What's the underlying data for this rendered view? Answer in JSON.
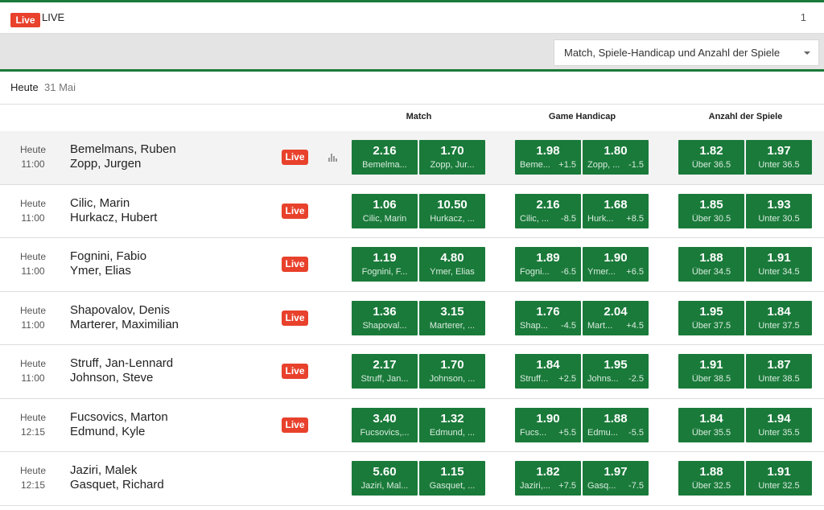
{
  "header": {
    "live_badge": "Live",
    "title": "LIVE",
    "count": "1"
  },
  "market_select": {
    "value": "Match, Spiele-Handicap und Anzahl der Spiele"
  },
  "datebar": {
    "day": "Heute",
    "date": "31 Mai"
  },
  "columns": {
    "match": "Match",
    "handicap": "Game Handicap",
    "total": "Anzahl der Spiele"
  },
  "live_label": "Live",
  "matches": [
    {
      "day": "Heute",
      "time": "11:00",
      "p1": "Bemelmans, Ruben",
      "p2": "Zopp, Jurgen",
      "live": true,
      "stats": true,
      "match": [
        {
          "v": "2.16",
          "n": "Bemelma..."
        },
        {
          "v": "1.70",
          "n": "Zopp, Jur..."
        }
      ],
      "handicap": [
        {
          "v": "1.98",
          "n": "Beme...",
          "h": "+1.5"
        },
        {
          "v": "1.80",
          "n": "Zopp, ...",
          "h": "-1.5"
        }
      ],
      "total": [
        {
          "v": "1.82",
          "n": "Über 36.5"
        },
        {
          "v": "1.97",
          "n": "Unter 36.5"
        }
      ]
    },
    {
      "day": "Heute",
      "time": "11:00",
      "p1": "Cilic, Marin",
      "p2": "Hurkacz, Hubert",
      "live": true,
      "stats": false,
      "match": [
        {
          "v": "1.06",
          "n": "Cilic, Marin"
        },
        {
          "v": "10.50",
          "n": "Hurkacz, ..."
        }
      ],
      "handicap": [
        {
          "v": "2.16",
          "n": "Cilic, ...",
          "h": "-8.5"
        },
        {
          "v": "1.68",
          "n": "Hurk...",
          "h": "+8.5"
        }
      ],
      "total": [
        {
          "v": "1.85",
          "n": "Über 30.5"
        },
        {
          "v": "1.93",
          "n": "Unter 30.5"
        }
      ]
    },
    {
      "day": "Heute",
      "time": "11:00",
      "p1": "Fognini, Fabio",
      "p2": "Ymer, Elias",
      "live": true,
      "stats": false,
      "match": [
        {
          "v": "1.19",
          "n": "Fognini, F..."
        },
        {
          "v": "4.80",
          "n": "Ymer, Elias"
        }
      ],
      "handicap": [
        {
          "v": "1.89",
          "n": "Fogni...",
          "h": "-6.5"
        },
        {
          "v": "1.90",
          "n": "Ymer...",
          "h": "+6.5"
        }
      ],
      "total": [
        {
          "v": "1.88",
          "n": "Über 34.5"
        },
        {
          "v": "1.91",
          "n": "Unter 34.5"
        }
      ]
    },
    {
      "day": "Heute",
      "time": "11:00",
      "p1": "Shapovalov, Denis",
      "p2": "Marterer, Maximilian",
      "live": true,
      "stats": false,
      "match": [
        {
          "v": "1.36",
          "n": "Shapoval..."
        },
        {
          "v": "3.15",
          "n": "Marterer, ..."
        }
      ],
      "handicap": [
        {
          "v": "1.76",
          "n": "Shap...",
          "h": "-4.5"
        },
        {
          "v": "2.04",
          "n": "Mart...",
          "h": "+4.5"
        }
      ],
      "total": [
        {
          "v": "1.95",
          "n": "Über 37.5"
        },
        {
          "v": "1.84",
          "n": "Unter 37.5"
        }
      ]
    },
    {
      "day": "Heute",
      "time": "11:00",
      "p1": "Struff, Jan-Lennard",
      "p2": "Johnson, Steve",
      "live": true,
      "stats": false,
      "match": [
        {
          "v": "2.17",
          "n": "Struff, Jan..."
        },
        {
          "v": "1.70",
          "n": "Johnson, ..."
        }
      ],
      "handicap": [
        {
          "v": "1.84",
          "n": "Struff...",
          "h": "+2.5"
        },
        {
          "v": "1.95",
          "n": "Johns...",
          "h": "-2.5"
        }
      ],
      "total": [
        {
          "v": "1.91",
          "n": "Über 38.5"
        },
        {
          "v": "1.87",
          "n": "Unter 38.5"
        }
      ]
    },
    {
      "day": "Heute",
      "time": "12:15",
      "p1": "Fucsovics, Marton",
      "p2": "Edmund, Kyle",
      "live": true,
      "stats": false,
      "match": [
        {
          "v": "3.40",
          "n": "Fucsovics,..."
        },
        {
          "v": "1.32",
          "n": "Edmund, ..."
        }
      ],
      "handicap": [
        {
          "v": "1.90",
          "n": "Fucs...",
          "h": "+5.5"
        },
        {
          "v": "1.88",
          "n": "Edmu...",
          "h": "-5.5"
        }
      ],
      "total": [
        {
          "v": "1.84",
          "n": "Über 35.5"
        },
        {
          "v": "1.94",
          "n": "Unter 35.5"
        }
      ]
    },
    {
      "day": "Heute",
      "time": "12:15",
      "p1": "Jaziri, Malek",
      "p2": "Gasquet, Richard",
      "live": false,
      "stats": false,
      "match": [
        {
          "v": "5.60",
          "n": "Jaziri, Mal..."
        },
        {
          "v": "1.15",
          "n": "Gasquet, ..."
        }
      ],
      "handicap": [
        {
          "v": "1.82",
          "n": "Jaziri,...",
          "h": "+7.5"
        },
        {
          "v": "1.97",
          "n": "Gasq...",
          "h": "-7.5"
        }
      ],
      "total": [
        {
          "v": "1.88",
          "n": "Über 32.5"
        },
        {
          "v": "1.91",
          "n": "Unter 32.5"
        }
      ]
    }
  ],
  "colors": {
    "green": "#1a7a3a",
    "live_red": "#e8412c"
  }
}
